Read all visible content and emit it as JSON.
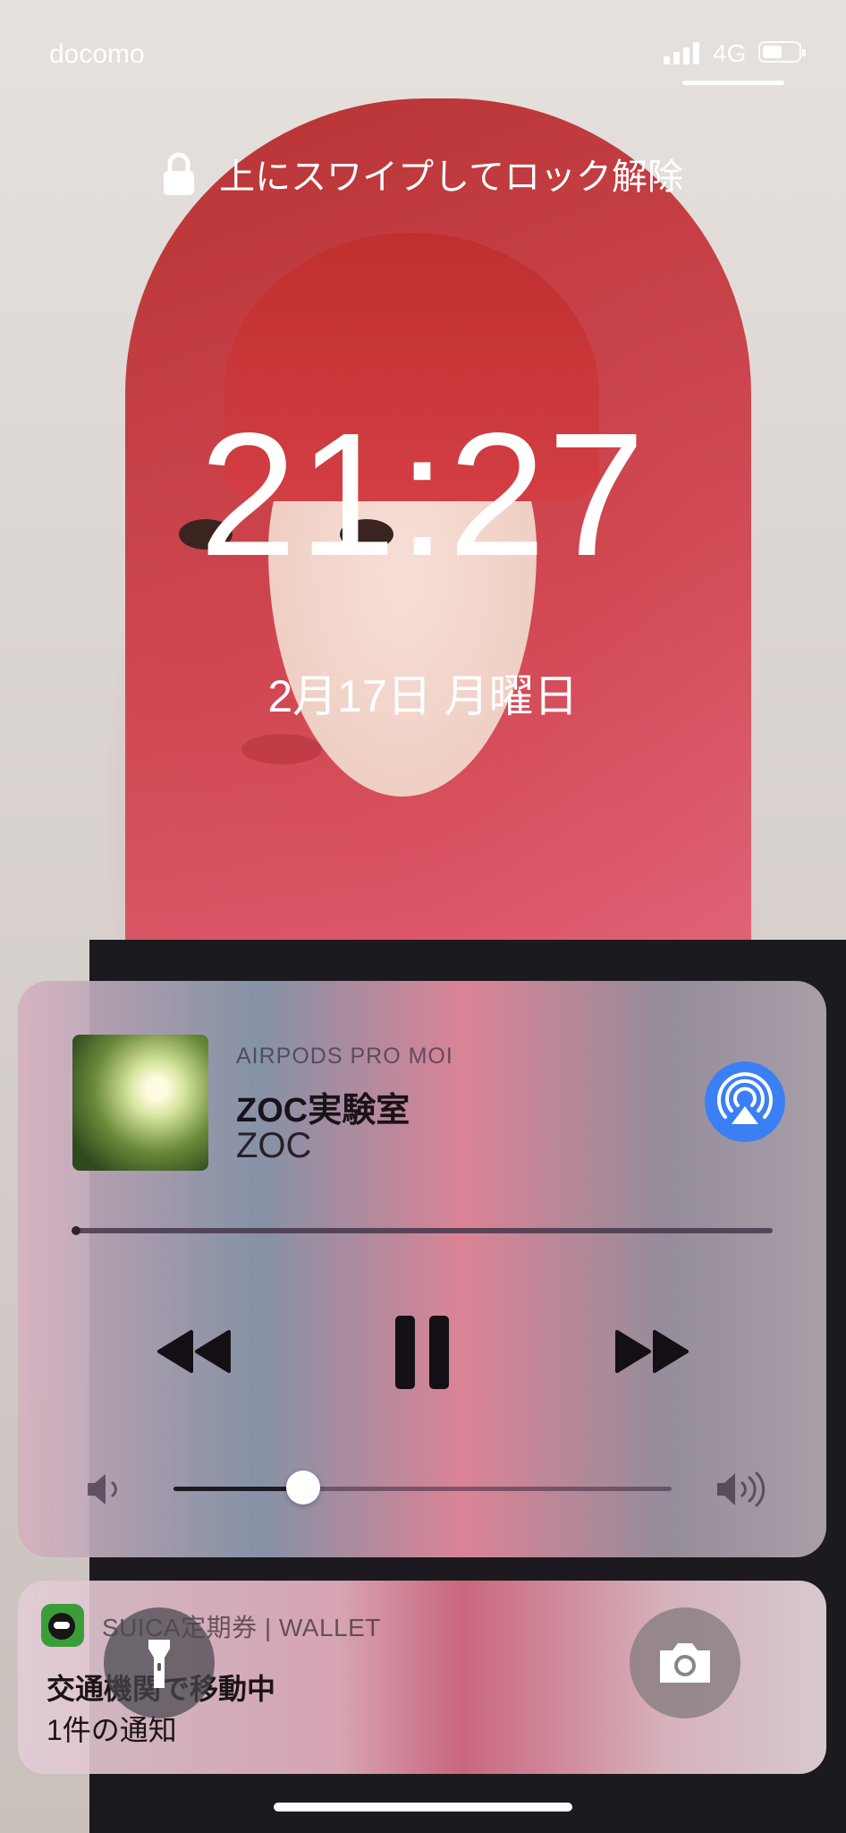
{
  "status_bar": {
    "carrier": "docomo",
    "network": "4G",
    "signal_bars": 4,
    "battery_level": 0.55
  },
  "lock_screen": {
    "unlock_hint": "上にスワイプしてロック解除",
    "time": "21:27",
    "date": "2月17日 月曜日"
  },
  "now_playing": {
    "source": "AIRPODS PRO MOI",
    "title": "ZOC実験室",
    "artist": "ZOC",
    "progress": 0.0,
    "volume": 0.26,
    "airplay_color": "#3b7ff5",
    "controls": [
      "rewind-icon",
      "pause-icon",
      "fast-forward-icon"
    ]
  },
  "notification": {
    "app_label": "SUICA定期券 | WALLET",
    "title": "交通機関で移動中",
    "body": "1件の通知"
  },
  "quick_actions": [
    "flashlight-icon",
    "camera-icon"
  ]
}
